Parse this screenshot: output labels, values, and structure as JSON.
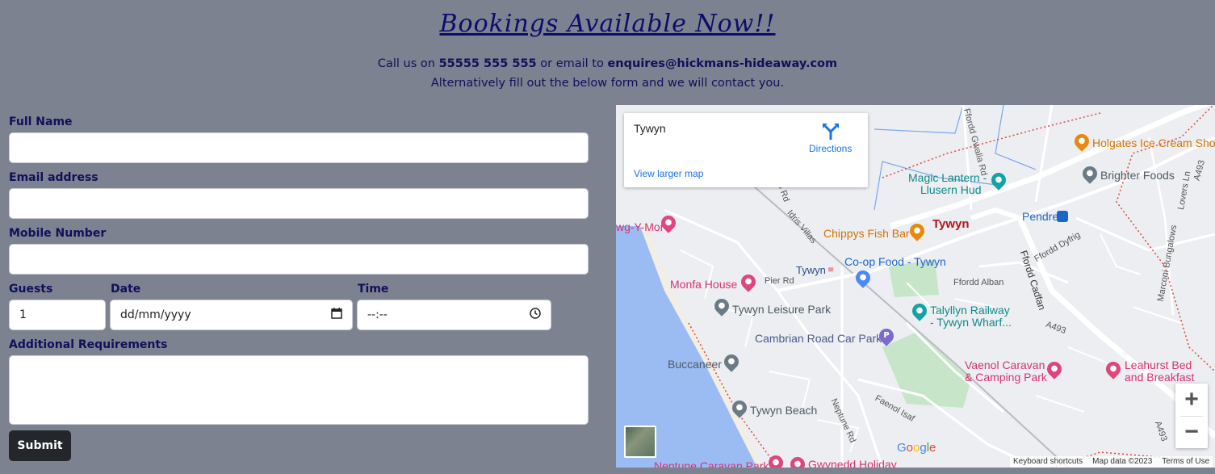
{
  "header": {
    "title": "Bookings Available Now!!",
    "call_prefix": "Call us on ",
    "phone": "55555 555 555",
    "email_prefix": " or email to ",
    "email": "enquires@hickmans-hideaway.com",
    "line2": "Alternatively fill out the below form and we will contact you."
  },
  "form": {
    "full_name_label": "Full Name",
    "email_label": "Email address",
    "mobile_label": "Mobile Number",
    "guests_label": "Guests",
    "guests_value": "1",
    "date_label": "Date",
    "date_placeholder": "dd/mm/yyyy",
    "time_label": "Time",
    "time_placeholder": "--:--",
    "requirements_label": "Additional Requirements",
    "submit_label": "Submit"
  },
  "map": {
    "card": {
      "place": "Tywyn",
      "directions": "Directions",
      "view_larger": "View larger map"
    },
    "places": {
      "holgates": "Holgates Ice Cream Sho",
      "brighter": "Brighter Foods",
      "magic1": "Magic Lantern -",
      "magic2": "Llusern Hud",
      "pendre": "Pendre",
      "tywyn_town": "Tywyn",
      "chippys": "Chippys Fish Bar",
      "ymor": "wg-Y-Mor",
      "coop": "Co-op Food - Tywyn",
      "tywyn_station": "Tywyn",
      "monfa": "Monfa House",
      "leisure": "Tywyn Leisure Park",
      "talyllyn1": "Talyllyn Railway",
      "talyllyn2": "- Tywyn Wharf...",
      "cambrian": "Cambrian Road Car Park",
      "buccaneer": "Buccaneer",
      "vaenol1": "Vaenol Caravan",
      "vaenol2": "& Camping Park",
      "leahurst1": "Leahurst Bed",
      "leahurst2": "and Breakfast",
      "beach": "Tywyn Beach",
      "neptune": "Neptune Caravan Park",
      "gwynedd": "Gwynedd Holiday"
    },
    "roads": {
      "a493_top": "A493",
      "a493_mid": "A493",
      "a493_bot": "A493",
      "gwalia": "Ffordd Gwalia Rd",
      "cadfan": "Ffordd Cadfan",
      "dyfrig": "Ffordd Dyfrig",
      "alban": "Ffordd Alban",
      "pier": "Pier Rd",
      "idris": "Idris Villas",
      "faenol": "Faenol Isaf",
      "neptune_rd": "Neptune Rd",
      "lovers": "Lovers Ln",
      "bungalows": "Marconi Bungalows",
      "rds": "ds Rd"
    },
    "google": "Google",
    "attribution": {
      "shortcuts": "Keyboard shortcuts",
      "data": "Map data ©2023",
      "terms": "Terms of Use"
    },
    "zoom_in": "+",
    "zoom_out": "−"
  },
  "icons": {
    "directions": "directions-icon",
    "calendar": "calendar-icon",
    "clock": "clock-icon"
  }
}
